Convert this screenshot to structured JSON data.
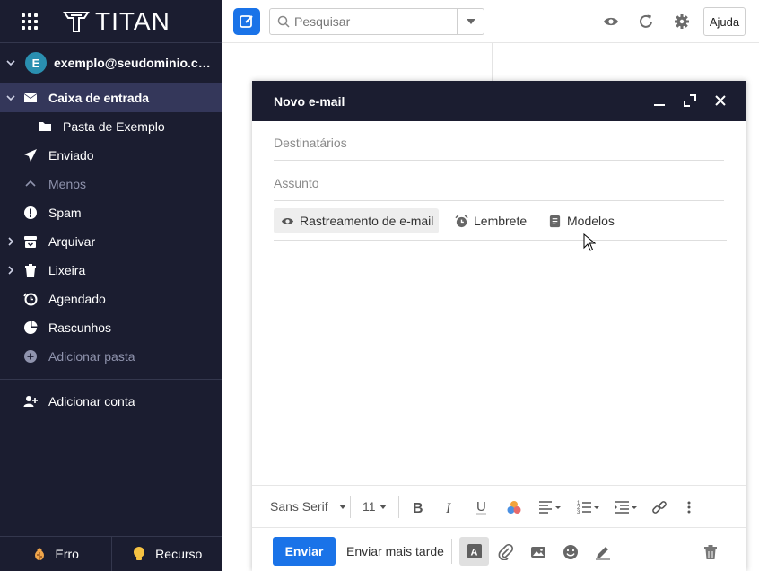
{
  "brand": {
    "name": "TITAN"
  },
  "account": {
    "initial": "E",
    "email": "exemplo@seudominio.co..."
  },
  "nav": {
    "inbox": "Caixa de entrada",
    "example_folder": "Pasta de Exemplo",
    "sent": "Enviado",
    "less": "Menos",
    "spam": "Spam",
    "archive": "Arquivar",
    "trash": "Lixeira",
    "scheduled": "Agendado",
    "drafts": "Rascunhos",
    "add_folder": "Adicionar pasta",
    "add_account": "Adicionar conta"
  },
  "sidebar_bottom": {
    "error": "Erro",
    "feature": "Recurso"
  },
  "search": {
    "placeholder": "Pesquisar"
  },
  "header": {
    "help": "Ajuda"
  },
  "compose": {
    "title": "Novo e-mail",
    "recipients_placeholder": "Destinatários",
    "subject_placeholder": "Assunto",
    "options": {
      "tracking": "Rastreamento de e-mail",
      "reminder": "Lembrete",
      "templates": "Modelos"
    },
    "toolbar": {
      "font": "Sans Serif",
      "size": "11"
    },
    "send": "Enviar",
    "send_later": "Enviar mais tarde"
  },
  "colors": {
    "sidebar_bg": "#1b1d30",
    "accent": "#1a73e8",
    "active_item_bg": "#34375a"
  }
}
